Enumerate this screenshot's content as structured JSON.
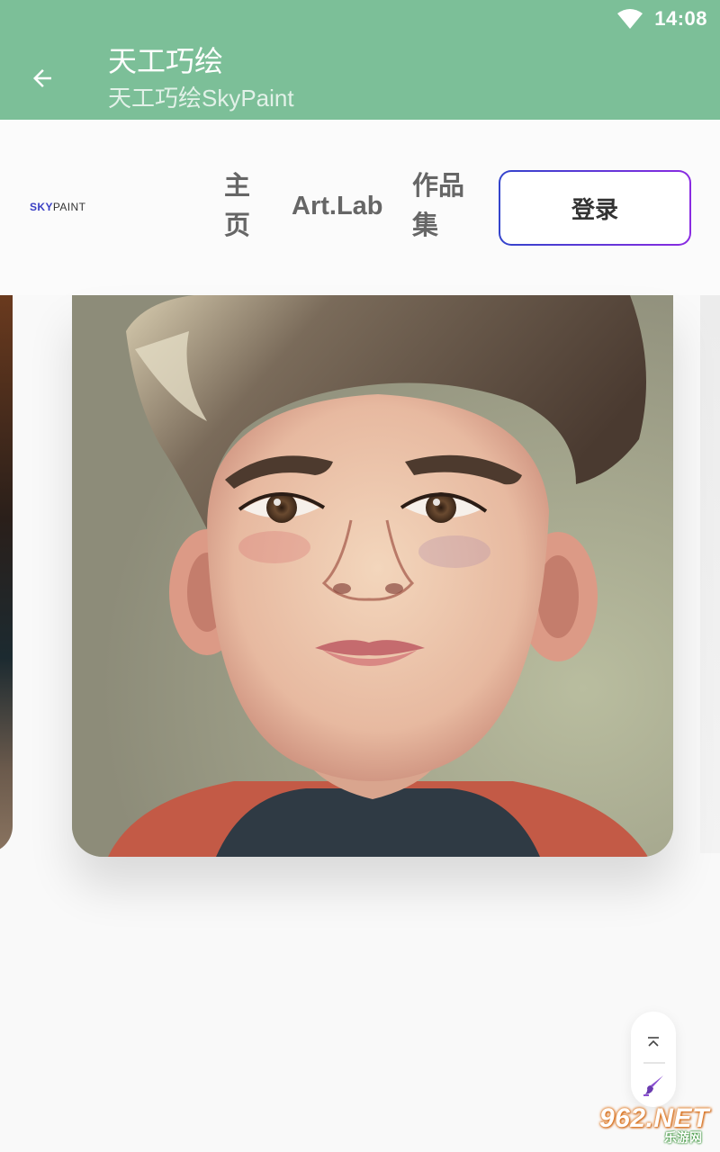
{
  "status_bar": {
    "time": "14:08",
    "wifi_icon": "wifi-icon"
  },
  "app_bar": {
    "back_icon": "arrow-left-icon",
    "title": "天工巧绘",
    "subtitle": "天工巧绘SkyPaint",
    "background": "#7cbf98"
  },
  "nav": {
    "logo_sky": "SKY",
    "logo_paint": "PAINT",
    "links": [
      {
        "label": "主页"
      },
      {
        "label": "Art.Lab"
      },
      {
        "label": "作品集"
      }
    ],
    "login_label": "登录",
    "login_border_gradient": [
      "#3344cc",
      "#8a2be2"
    ]
  },
  "carousel": {
    "main_image": "portrait-boy-illustration"
  },
  "floating_tools": {
    "to_top_icon": "chevron-up-bar-icon",
    "paint_icon": "paintbrush-icon"
  },
  "watermark": {
    "main": "962.NET",
    "sub": "乐游网"
  }
}
